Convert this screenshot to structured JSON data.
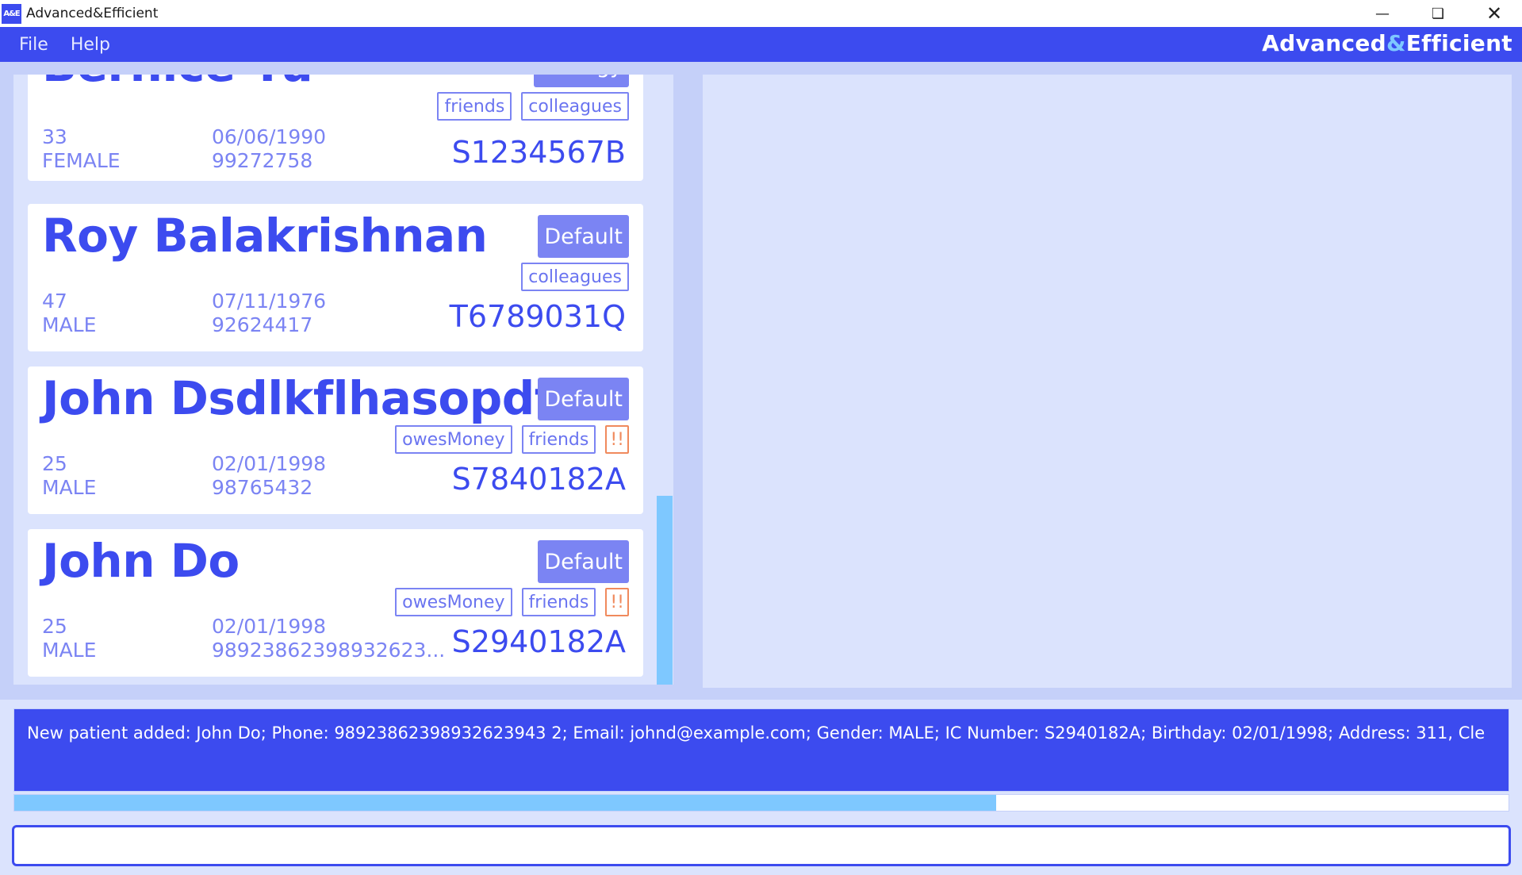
{
  "window": {
    "icon_text": "A&E",
    "title": "Advanced&Efficient",
    "minimize_icon": "minimize-icon",
    "restore_icon": "restore-icon",
    "close_icon": "close-icon"
  },
  "menu": {
    "file": "File",
    "help": "Help",
    "brand_part1": "Advanced",
    "brand_amp": "&",
    "brand_part2": "Efficient"
  },
  "patients": [
    {
      "name": "Bernice Yu",
      "badge": "Urology",
      "tags": [
        "friends",
        "colleagues"
      ],
      "age": "33",
      "gender": "FEMALE",
      "birthday": "06/06/1990",
      "phone": "99272758",
      "ic": "S1234567B"
    },
    {
      "name": "Roy Balakrishnan",
      "badge": "Default",
      "tags": [
        "colleagues"
      ],
      "age": "47",
      "gender": "MALE",
      "birthday": "07/11/1976",
      "phone": "92624417",
      "ic": "T6789031Q"
    },
    {
      "name": "John Dsdlkflhasopdf...",
      "badge": "Default",
      "tags": [
        "owesMoney",
        "friends"
      ],
      "priority": "!!",
      "age": "25",
      "gender": "MALE",
      "birthday": "02/01/1998",
      "phone": "98765432",
      "ic": "S7840182A"
    },
    {
      "name": "John Do",
      "badge": "Default",
      "tags": [
        "owesMoney",
        "friends"
      ],
      "priority": "!!",
      "age": "25",
      "gender": "MALE",
      "birthday": "02/01/1998",
      "phone": "98923862398932623...",
      "ic": "S2940182A"
    }
  ],
  "result": {
    "message": "New patient added: John Do; Phone: 98923862398932623943 2; Email: johnd@example.com; Gender: MALE; IC Number: S2940182A; Birthday: 02/01/1998; Address: 311, Cle",
    "progress": 0.657
  },
  "command": {
    "value": ""
  },
  "colors": {
    "primary": "#3c4bef",
    "accent": "#7ec8ff",
    "tag": "#7b84f3",
    "warning": "#f08a5d",
    "panel": "#dbe3fd"
  }
}
